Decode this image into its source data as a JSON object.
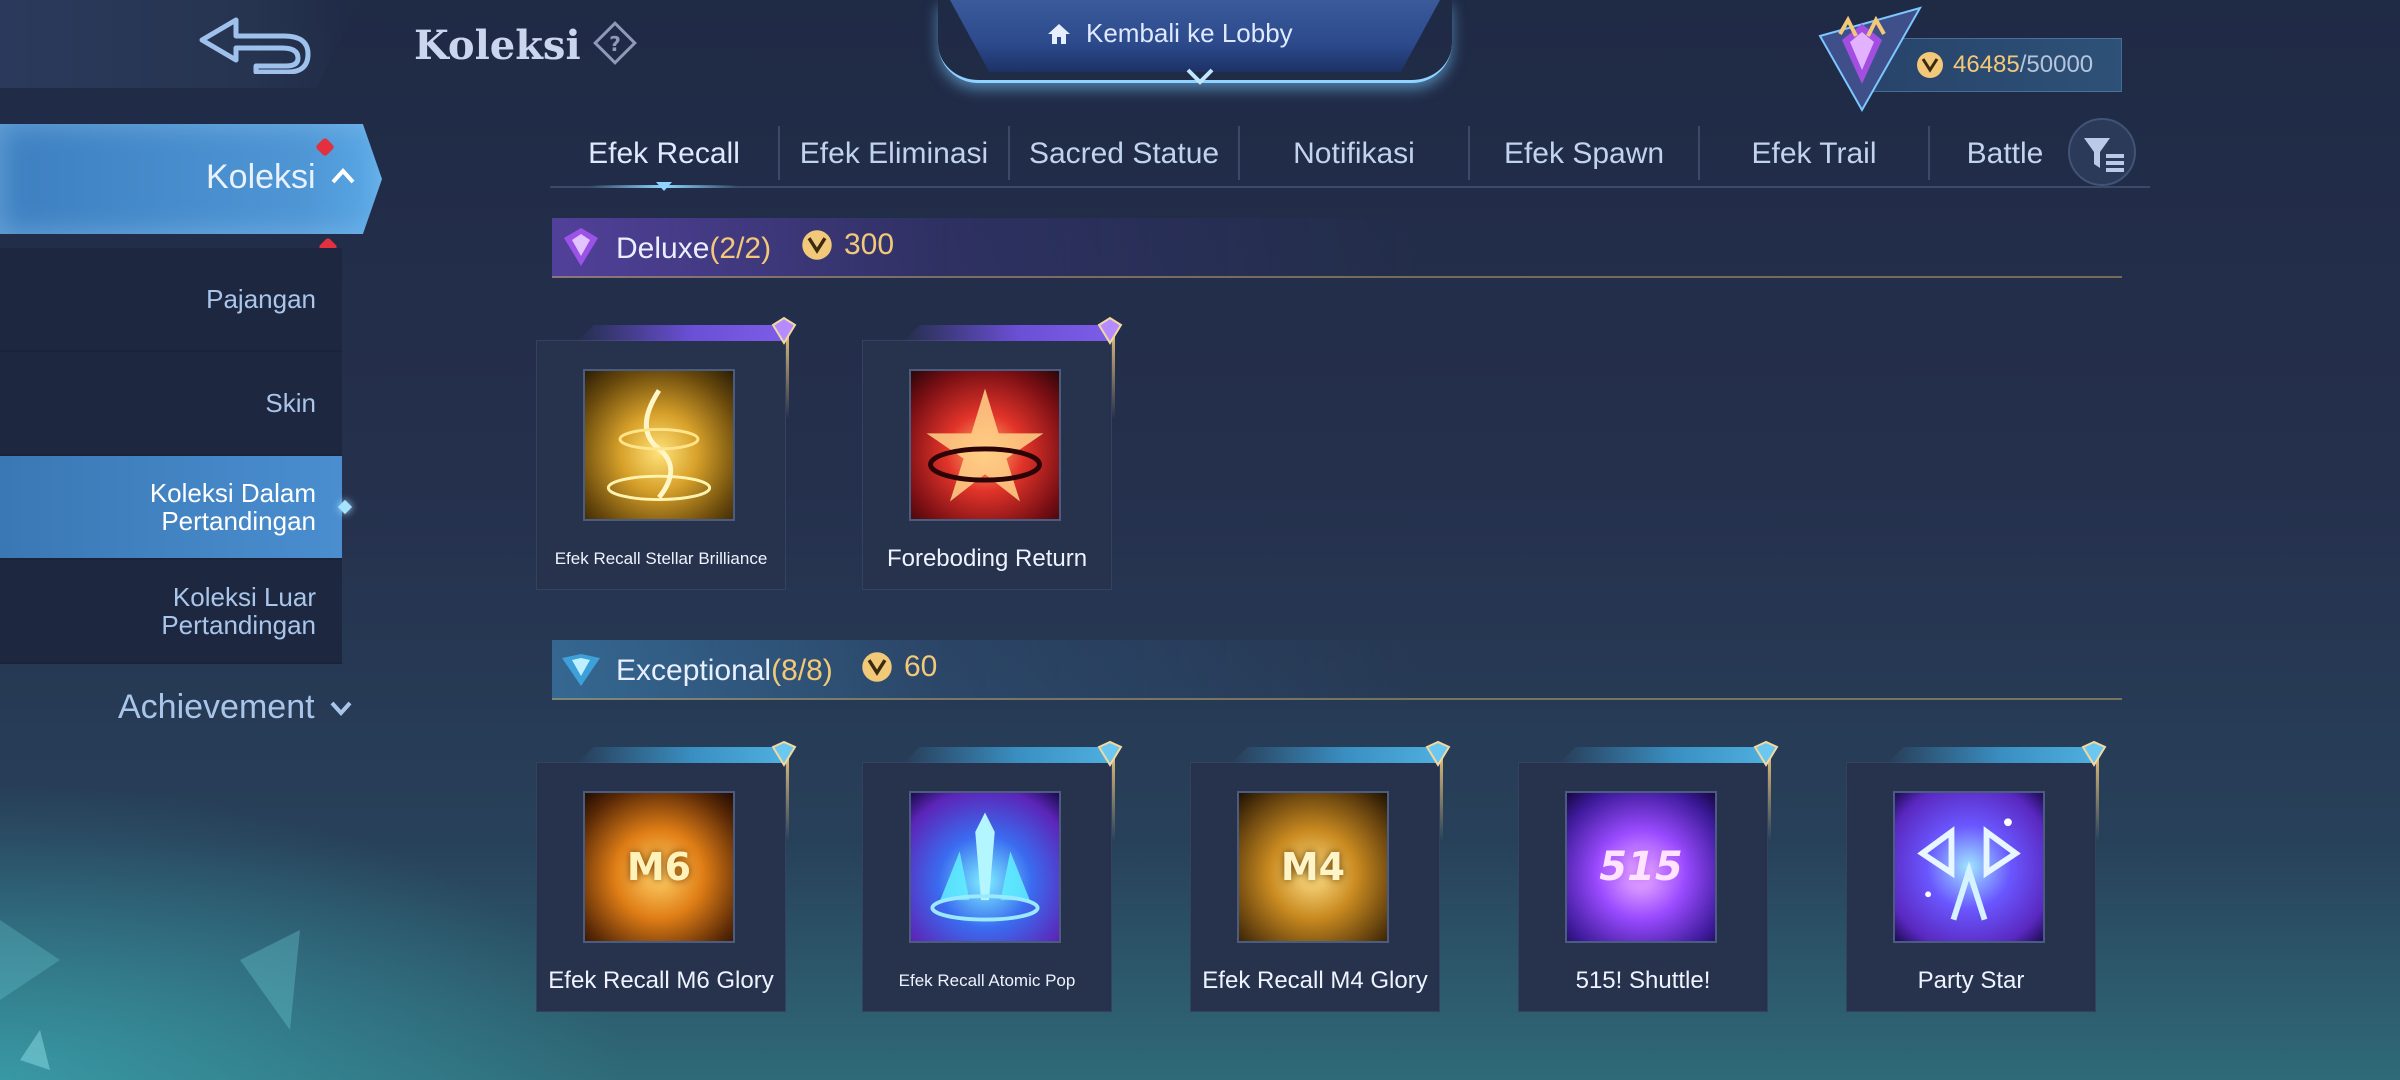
{
  "header": {
    "title": "Koleksi",
    "lobby_label": "Kembali ke Lobby",
    "currency_current": "46485",
    "currency_max": "/50000"
  },
  "sidebar": {
    "main_label": "Koleksi",
    "items": [
      {
        "label": "Pajangan"
      },
      {
        "label": "Skin"
      },
      {
        "label": "Koleksi Dalam Pertandingan"
      },
      {
        "label": "Koleksi Luar Pertandingan"
      }
    ],
    "achievement_label": "Achievement"
  },
  "tabs": [
    {
      "label": "Efek Recall"
    },
    {
      "label": "Efek Eliminasi"
    },
    {
      "label": "Sacred Statue"
    },
    {
      "label": "Notifikasi"
    },
    {
      "label": "Efek Spawn"
    },
    {
      "label": "Efek Trail"
    },
    {
      "label": "Battle"
    }
  ],
  "sections": {
    "deluxe": {
      "name": "Deluxe",
      "count": "(2/2)",
      "points": "300",
      "items": [
        {
          "name": "Efek Recall Stellar Brilliance"
        },
        {
          "name": "Foreboding Return"
        }
      ]
    },
    "exceptional": {
      "name": "Exceptional",
      "count": "(8/8)",
      "points": "60",
      "items": [
        {
          "name": "Efek Recall M6 Glory",
          "badge": "M6"
        },
        {
          "name": "Efek Recall Atomic Pop"
        },
        {
          "name": "Efek Recall M4 Glory",
          "badge": "M4"
        },
        {
          "name": "515! Shuttle!",
          "badge": "515"
        },
        {
          "name": "Party Star"
        }
      ]
    }
  },
  "colors": {
    "accent_gold": "#f2c879",
    "active_blue": "#4a8ed0",
    "deluxe_purple": "#7d5de8",
    "exceptional_teal": "#4fb0e0"
  }
}
